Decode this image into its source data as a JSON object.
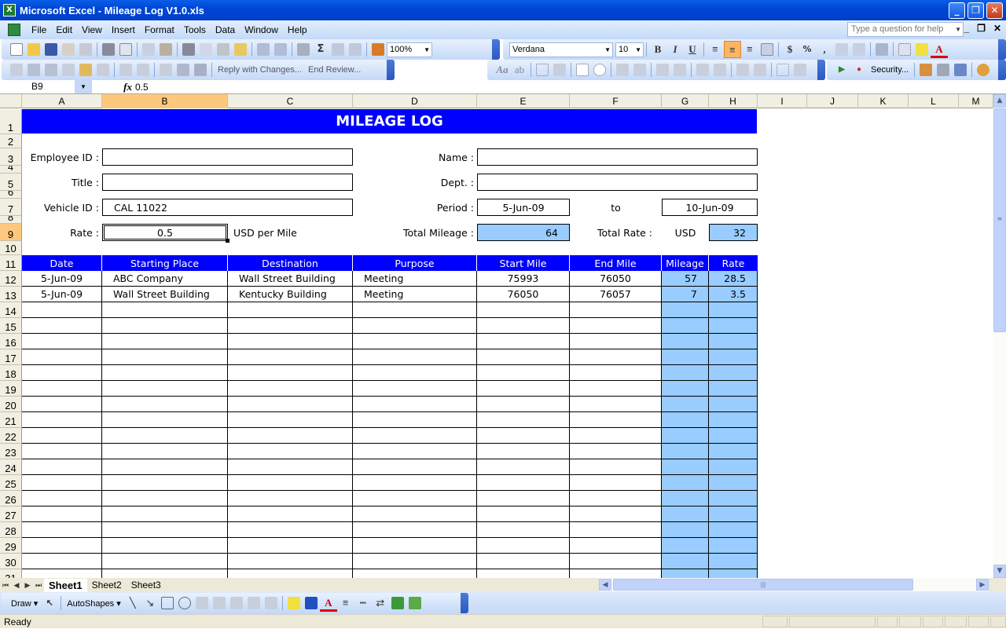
{
  "window": {
    "title": "Microsoft Excel - Mileage Log V1.0.xls"
  },
  "menu": [
    "File",
    "Edit",
    "View",
    "Insert",
    "Format",
    "Tools",
    "Data",
    "Window",
    "Help"
  ],
  "help_placeholder": "Type a question for help",
  "toolbar": {
    "zoom": "100%",
    "font": "Verdana",
    "font_size": "10",
    "reply_with_changes": "Reply with Changes...",
    "end_review": "End Review...",
    "security": "Security...",
    "bold": "B",
    "italic": "I",
    "underline": "U"
  },
  "formula_bar": {
    "name_box": "B9",
    "fx": "fx",
    "value": "0.5"
  },
  "columns": [
    "A",
    "B",
    "C",
    "D",
    "E",
    "F",
    "G",
    "H",
    "I",
    "J",
    "K",
    "L",
    "M"
  ],
  "selected_column": "B",
  "selected_row": 9,
  "sheet": {
    "title": "MILEAGE LOG",
    "labels": {
      "employee_id": "Employee ID :",
      "name": "Name :",
      "title": "Title :",
      "dept": "Dept. :",
      "vehicle_id": "Vehicle ID :",
      "period": "Period :",
      "to": "to",
      "rate": "Rate :",
      "usd_per_mile": "USD per Mile",
      "total_mileage": "Total Mileage :",
      "total_rate": "Total Rate :",
      "usd": "USD"
    },
    "values": {
      "employee_id": "",
      "name": "",
      "title": "",
      "dept": "",
      "vehicle_id": "CAL 11022",
      "period_start": "5-Jun-09",
      "period_end": "10-Jun-09",
      "rate": "0.5",
      "total_mileage": "64",
      "total_rate": "32"
    },
    "table_headers": [
      "Date",
      "Starting Place",
      "Destination",
      "Purpose",
      "Start Mile",
      "End Mile",
      "Mileage",
      "Rate"
    ],
    "table_rows": [
      [
        "5-Jun-09",
        "ABC Company",
        "Wall Street Building",
        "Meeting",
        "75993",
        "76050",
        "57",
        "28.5"
      ],
      [
        "5-Jun-09",
        "Wall Street Building",
        "Kentucky Building",
        "Meeting",
        "76050",
        "76057",
        "7",
        "3.5"
      ]
    ]
  },
  "sheet_tabs": [
    "Sheet1",
    "Sheet2",
    "Sheet3"
  ],
  "active_sheet": "Sheet1",
  "draw_toolbar": {
    "draw": "Draw",
    "autoshapes": "AutoShapes"
  },
  "status": "Ready"
}
